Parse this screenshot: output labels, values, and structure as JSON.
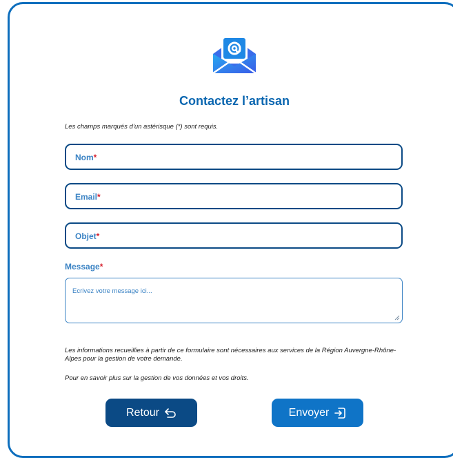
{
  "form": {
    "title": "Contactez l’artisan",
    "required_note": "Les champs marqués d’un astérisque (*) sont requis.",
    "fields": [
      {
        "label": "Nom",
        "required_mark": "*"
      },
      {
        "label": "Email",
        "required_mark": "*"
      },
      {
        "label": "Objet",
        "required_mark": "*"
      }
    ],
    "message": {
      "label": "Message",
      "required_mark": "*",
      "placeholder": "Ecrivez votre message ici..."
    },
    "info_text": "Les informations recueillies à partir de ce formulaire sont nécessaires aux services de la Région Auvergne-Rhône-Alpes pour la gestion de votre demande.",
    "privacy_text": "Pour en savoir plus sur la gestion de vos données et vos droits.",
    "buttons": {
      "back_label": "Retour",
      "send_label": "Envoyer"
    }
  },
  "icons": {
    "logo": "mail-envelope-at-icon",
    "back": "undo-arrow-icon",
    "send": "login-arrow-icon"
  },
  "colors": {
    "accent": "#0a66b0",
    "border": "#0b4a85",
    "required": "#d61f2c",
    "send_button": "#0f74c7",
    "back_button": "#0b4a85"
  }
}
